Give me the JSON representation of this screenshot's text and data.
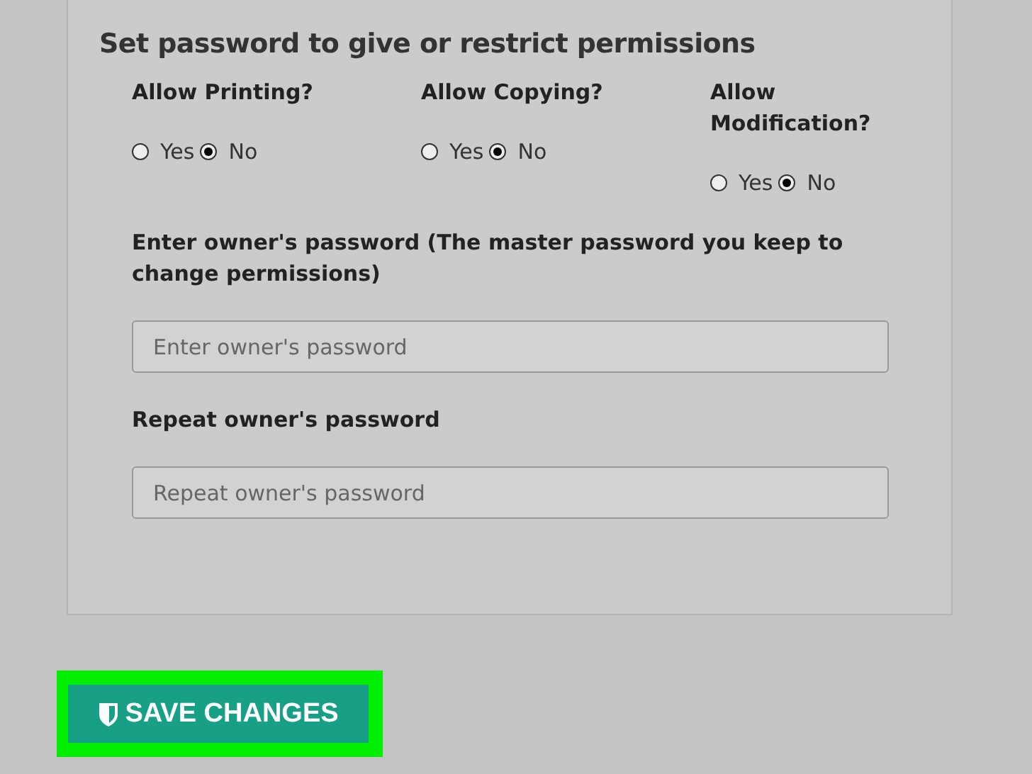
{
  "section_title": "Set password to give or restrict permissions",
  "permissions": [
    {
      "label": "Allow Printing?",
      "options": [
        {
          "label": "Yes",
          "selected": false
        },
        {
          "label": "No",
          "selected": true
        }
      ]
    },
    {
      "label": "Allow Copying?",
      "options": [
        {
          "label": "Yes",
          "selected": false
        },
        {
          "label": "No",
          "selected": true
        }
      ]
    },
    {
      "label": "Allow Modification?",
      "options": [
        {
          "label": "Yes",
          "selected": false
        },
        {
          "label": "No",
          "selected": true
        }
      ]
    }
  ],
  "fields": [
    {
      "label": "Enter owner's password (The master password you keep to change permissions)",
      "placeholder": "Enter owner's password"
    },
    {
      "label": "Repeat owner's password",
      "placeholder": "Repeat owner's password"
    }
  ],
  "save_button": {
    "label": "SAVE CHANGES",
    "highlighted": true
  }
}
